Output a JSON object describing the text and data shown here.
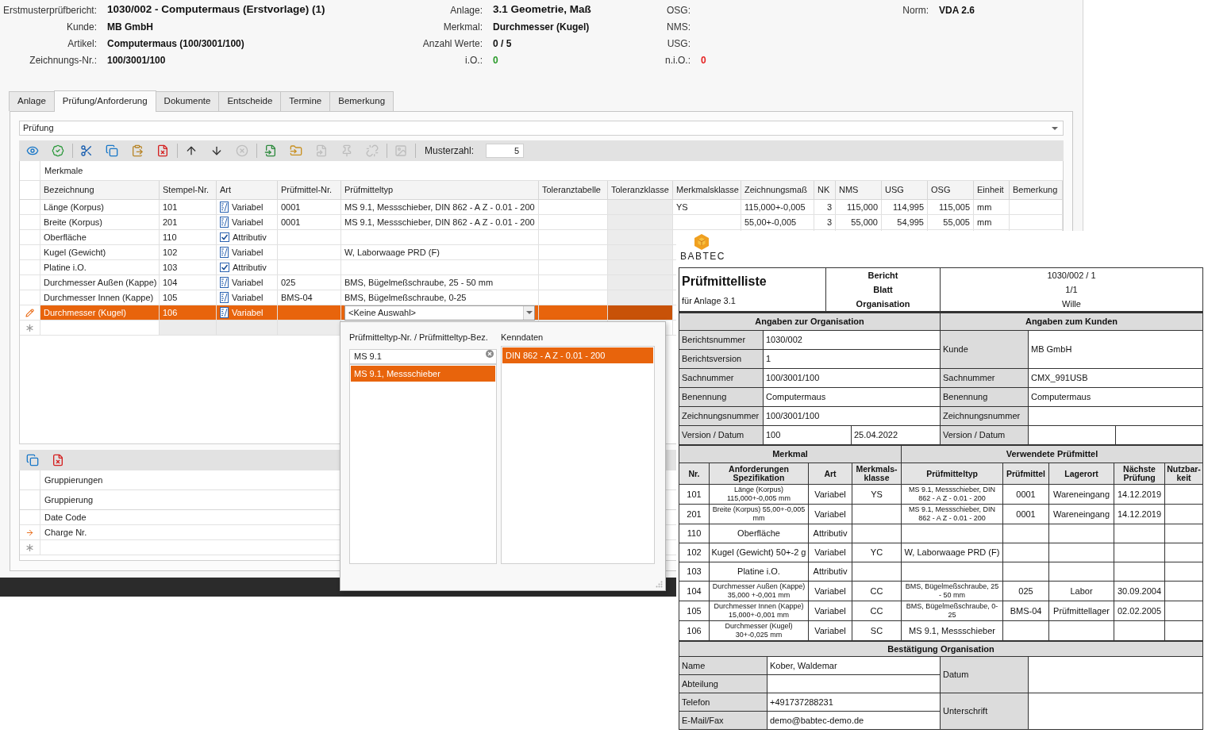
{
  "header": {
    "groups": [
      [
        {
          "label": "Erstmusterprüfbericht:",
          "value": "1030/002 - Computermaus (Erstvorlage) (1)",
          "kind": "title"
        },
        {
          "label": "Kunde:",
          "value": "MB GmbH",
          "kind": "plain"
        },
        {
          "label": "Artikel:",
          "value": "Computermaus (100/3001/100)",
          "kind": "plain"
        },
        {
          "label": "Zeichnungs-Nr.:",
          "value": "100/3001/100",
          "kind": "plain"
        }
      ],
      [
        {
          "label": "Anlage:",
          "value": "3.1 Geometrie, Maß",
          "kind": "title"
        },
        {
          "label": "Merkmal:",
          "value": "Durchmesser (Kugel)",
          "kind": "plain"
        },
        {
          "label": "Anzahl Werte:",
          "value": "0 / 5",
          "kind": "plain"
        },
        {
          "label": "i.O.:",
          "value": "0",
          "kind": "ok"
        }
      ],
      [
        {
          "label": "OSG:"
        },
        {
          "label": "NMS:"
        },
        {
          "label": "USG:"
        },
        {
          "label": "n.i.O.:",
          "value": "0",
          "kind": "fail"
        }
      ],
      [
        {
          "label": "Norm:",
          "value": "VDA 2.6",
          "kind": "plain"
        }
      ]
    ]
  },
  "tabs": [
    {
      "label": "Anlage",
      "selected": false
    },
    {
      "label": "Prüfung/Anforderung",
      "selected": true
    },
    {
      "label": "Dokumente",
      "selected": false
    },
    {
      "label": "Entscheide",
      "selected": false
    },
    {
      "label": "Termine",
      "selected": false
    },
    {
      "label": "Bemerkung",
      "selected": false
    }
  ],
  "filter": {
    "value": "Prüfung"
  },
  "toolbar": {
    "groups": [
      [
        {
          "kind": "view",
          "disabled": false
        },
        {
          "kind": "approve",
          "disabled": false
        }
      ],
      [
        {
          "kind": "cut",
          "disabled": false
        },
        {
          "kind": "copy",
          "disabled": false
        },
        {
          "kind": "paste",
          "disabled": false
        },
        {
          "kind": "delete",
          "disabled": false
        }
      ],
      [
        {
          "kind": "up",
          "disabled": false
        },
        {
          "kind": "down",
          "disabled": false
        },
        {
          "kind": "cancel",
          "disabled": true
        }
      ],
      [
        {
          "kind": "import",
          "disabled": false
        },
        {
          "kind": "folder",
          "disabled": false
        },
        {
          "kind": "link",
          "disabled": true
        },
        {
          "kind": "pin",
          "disabled": true
        },
        {
          "kind": "unlink",
          "disabled": true
        }
      ],
      [
        {
          "kind": "image",
          "disabled": true
        }
      ]
    ],
    "sample_count": {
      "label": "Musterzahl:",
      "value": "5"
    }
  },
  "grid": {
    "group_label": "Merkmale",
    "columns": [
      "Bezeichnung",
      "Stempel-Nr.",
      "Art",
      "Prüfmittel-Nr.",
      "Prüfmitteltyp",
      "Toleranztabelle",
      "Toleranzklasse",
      "Merkmalsklasse",
      "Zeichnungsmaß",
      "NK",
      "NMS",
      "USG",
      "OSG",
      "Einheit",
      "Bemerkung"
    ],
    "rows": [
      {
        "selected": false,
        "cells": [
          "Länge (Korpus)",
          "101",
          {
            "kind": "variable",
            "text": "Variabel"
          },
          "0001",
          "MS 9.1, Messschieber, DIN 862 - A Z - 0.01 - 200",
          null,
          null,
          "YS",
          "115,000+-0,005",
          "3",
          "115,000",
          "114,995",
          "115,005",
          "mm"
        ]
      },
      {
        "selected": false,
        "cells": [
          "Breite (Korpus)",
          "201",
          {
            "kind": "variable",
            "text": "Variabel"
          },
          "0001",
          "MS 9.1, Messschieber, DIN 862 - A Z - 0.01 - 200",
          null,
          null,
          null,
          "55,00+-0,005",
          "3",
          "55,000",
          "54,995",
          "55,005",
          "mm"
        ]
      },
      {
        "selected": false,
        "cells": [
          "Oberfläche",
          "110",
          {
            "kind": "attribute",
            "text": "Attributiv"
          }
        ]
      },
      {
        "selected": false,
        "cells": [
          "Kugel (Gewicht)",
          "102",
          {
            "kind": "variable",
            "text": "Variabel"
          },
          null,
          "W, Laborwaage PRD (F)"
        ]
      },
      {
        "selected": false,
        "cells": [
          "Platine i.O.",
          "103",
          {
            "kind": "attribute",
            "text": "Attributiv"
          }
        ]
      },
      {
        "selected": false,
        "cells": [
          "Durchmesser Außen (Kappe)",
          "104",
          {
            "kind": "variable",
            "text": "Variabel"
          },
          "025",
          "BMS, Bügelmeßschraube, 25 - 50 mm"
        ]
      },
      {
        "selected": false,
        "cells": [
          "Durchmesser Innen (Kappe)",
          "105",
          {
            "kind": "variable",
            "text": "Variabel"
          },
          "BMS-04",
          "BMS, Bügelmeßschraube, 0-25"
        ]
      },
      {
        "selected": true,
        "cells": [
          "Durchmesser (Kugel)",
          "106",
          {
            "kind": "variable",
            "text": "Variabel"
          },
          null,
          {
            "kind": "editor",
            "text": "<Keine Auswahl>"
          }
        ]
      }
    ]
  },
  "groupings": {
    "toolbar": [
      {
        "kind": "copy",
        "disabled": false
      },
      {
        "kind": "delete",
        "disabled": false
      }
    ],
    "group_label": "Gruppierungen",
    "column": "Gruppierung",
    "rows": [
      {
        "label": "Date Code",
        "current": false
      },
      {
        "label": "Charge Nr.",
        "current": true
      }
    ]
  },
  "lookup_popup": {
    "left_header": "Prüfmitteltyp-Nr. / Prüfmitteltyp-Bez.",
    "right_header": "Kenndaten",
    "search": {
      "value": "MS 9.1"
    },
    "left_items": [
      {
        "label": "MS 9.1, Messschieber",
        "selected": true
      }
    ],
    "right_items": [
      {
        "label": "DIN 862 - A Z - 0.01 - 200",
        "selected": true
      }
    ]
  },
  "report": {
    "logo": "BABTEC",
    "title": "Prüfmittelliste",
    "subtitle": "für Anlage 3.1",
    "meta": [
      {
        "label": "Bericht",
        "value": "1030/002 / 1"
      },
      {
        "label": "Blatt",
        "value": "1/1"
      },
      {
        "label": "Organisation",
        "value": "Wille"
      }
    ],
    "organisation": {
      "title": "Angaben zur Organisation",
      "rows": [
        {
          "label": "Berichtsnummer",
          "values": [
            "1030/002"
          ]
        },
        {
          "label": "Berichtsversion",
          "values": [
            "1"
          ]
        },
        {
          "label": "Sachnummer",
          "values": [
            "100/3001/100"
          ]
        },
        {
          "label": "Benennung",
          "values": [
            "Computermaus"
          ]
        },
        {
          "label": "Zeichnungsnummer",
          "values": [
            "100/3001/100"
          ]
        },
        {
          "label": "Version / Datum",
          "values": [
            "100",
            "25.04.2022"
          ]
        }
      ]
    },
    "customer": {
      "title": "Angaben zum Kunden",
      "rows": [
        {
          "label": "Kunde",
          "values": [
            "MB GmbH"
          ]
        },
        {
          "label": "Sachnummer",
          "values": [
            "CMX_991USB"
          ]
        },
        {
          "label": "Benennung",
          "values": [
            "Computermaus"
          ]
        },
        {
          "label": "Zeichnungsnummer"
        },
        {
          "label": "Version / Datum"
        }
      ]
    },
    "feature_table": {
      "left_title": "Merkmal",
      "right_title": "Verwendete Prüfmittel",
      "columns": [
        "Nr.",
        "Anforderungen Spezifikation",
        "Art",
        "Merkmals-klasse",
        "Prüfmitteltyp",
        "Prüfmittel",
        "Lagerort",
        "Nächste Prüfung",
        "Nutzbar-keit"
      ],
      "rows": [
        [
          "101",
          "Länge (Korpus) 115,000+-0,005 mm",
          "Variabel",
          "YS",
          "MS 9.1, Messschieber, DIN 862 - A Z - 0.01 - 200",
          "0001",
          "Wareneingang",
          "14.12.2019"
        ],
        [
          "201",
          "Breite (Korpus) 55,00+-0,005 mm",
          "Variabel",
          null,
          "MS 9.1, Messschieber, DIN 862 - A Z - 0.01 - 200",
          "0001",
          "Wareneingang",
          "14.12.2019"
        ],
        [
          "110",
          "Oberfläche",
          "Attributiv"
        ],
        [
          "102",
          "Kugel (Gewicht) 50+-2 g",
          "Variabel",
          "YC",
          "W, Laborwaage PRD (F)"
        ],
        [
          "103",
          "Platine i.O.",
          "Attributiv"
        ],
        [
          "104",
          "Durchmesser Außen (Kappe) 35,000 +-0,001 mm",
          "Variabel",
          "CC",
          "BMS, Bügelmeßschraube, 25 - 50 mm",
          "025",
          "Labor",
          "30.09.2004"
        ],
        [
          "105",
          "Durchmesser Innen (Kappe) 15,000+-0,001 mm",
          "Variabel",
          "CC",
          "BMS, Bügelmeßschraube, 0-25",
          "BMS-04",
          "Prüfmittellager",
          "02.02.2005"
        ],
        [
          "106",
          "Durchmesser (Kugel) 30+-0,025 mm",
          "Variabel",
          "SC",
          "MS 9.1, Messschieber"
        ]
      ]
    },
    "confirmation": {
      "title": "Bestätigung Organisation",
      "rows": [
        {
          "label": "Name",
          "value": "Kober, Waldemar"
        },
        {
          "label": "Abteilung"
        },
        {
          "label": "Telefon",
          "value": "+491737288231"
        },
        {
          "label": "E-Mail/Fax",
          "value": "demo@babtec-demo.de"
        }
      ],
      "side_fields": [
        {
          "label": "Datum"
        },
        {
          "label": "Unterschrift"
        }
      ]
    }
  }
}
